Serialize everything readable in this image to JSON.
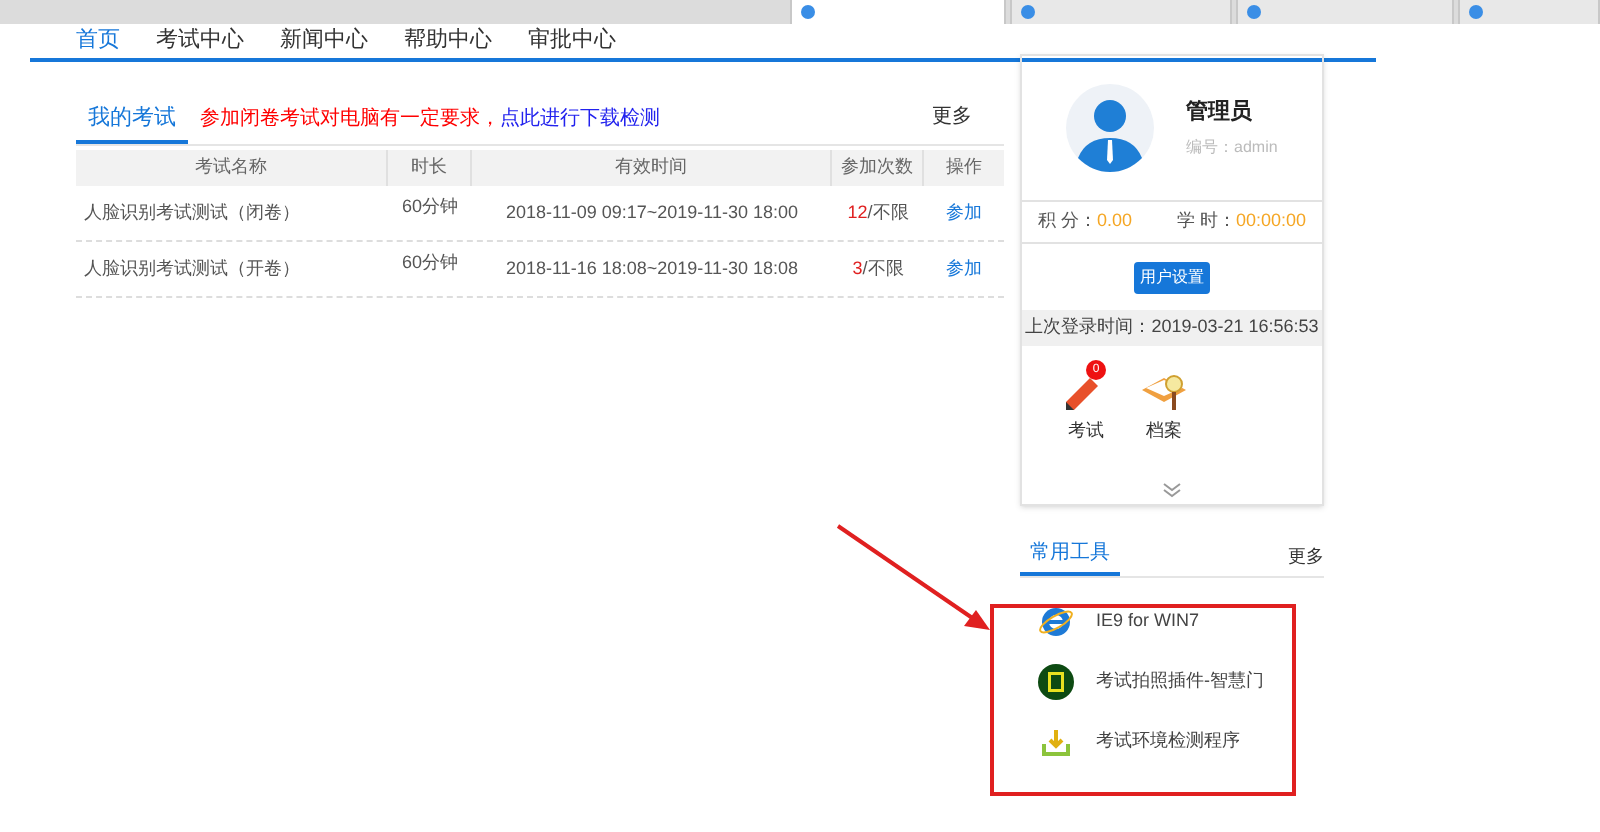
{
  "browser_tabs": [
    {
      "selected": true
    },
    {
      "selected": false
    },
    {
      "selected": false
    },
    {
      "selected": false
    }
  ],
  "nav": [
    {
      "label": "首页",
      "selected": true
    },
    {
      "label": "考试中心",
      "selected": false
    },
    {
      "label": "新闻中心",
      "selected": false
    },
    {
      "label": "帮助中心",
      "selected": false
    },
    {
      "label": "审批中心",
      "selected": false
    }
  ],
  "my_exams": {
    "title": "我的考试",
    "notice_red": "参加闭卷考试对电脑有一定要求，",
    "notice_link": "点此进行下载检测",
    "more": "更多",
    "columns": [
      "考试名称",
      "时长",
      "有效时间",
      "参加次数",
      "操作"
    ],
    "rows": [
      {
        "name": "人脸识别考试测试（闭卷）",
        "duration": "60分钟",
        "period": "2018-11-09 09:17~2019-11-30 18:00",
        "count": "12",
        "limit": "/不限",
        "action": "参加"
      },
      {
        "name": "人脸识别考试测试（开卷）",
        "duration": "60分钟",
        "period": "2018-11-16 18:08~2019-11-30 18:08",
        "count": "3",
        "limit": "/不限",
        "action": "参加"
      }
    ]
  },
  "user": {
    "name": "管理员",
    "id_label": "编号：admin",
    "points_label": "积 分：",
    "points": "0.00",
    "hours_label": "学 时：",
    "hours": "00:00:00",
    "settings_button": "用户设置",
    "last_login": "上次登录时间：2019-03-21 16:56:53",
    "shortcuts": [
      {
        "label": "考试",
        "kind": "pencil",
        "badge": "0"
      },
      {
        "label": "档案",
        "kind": "book"
      }
    ]
  },
  "tools": {
    "title": "常用工具",
    "more": "更多",
    "items": [
      {
        "label": "IE9 for WIN7",
        "kind": "ie"
      },
      {
        "label": "考试拍照插件-智慧门",
        "kind": "chip"
      },
      {
        "label": "考试环境检测程序",
        "kind": "download"
      }
    ]
  }
}
